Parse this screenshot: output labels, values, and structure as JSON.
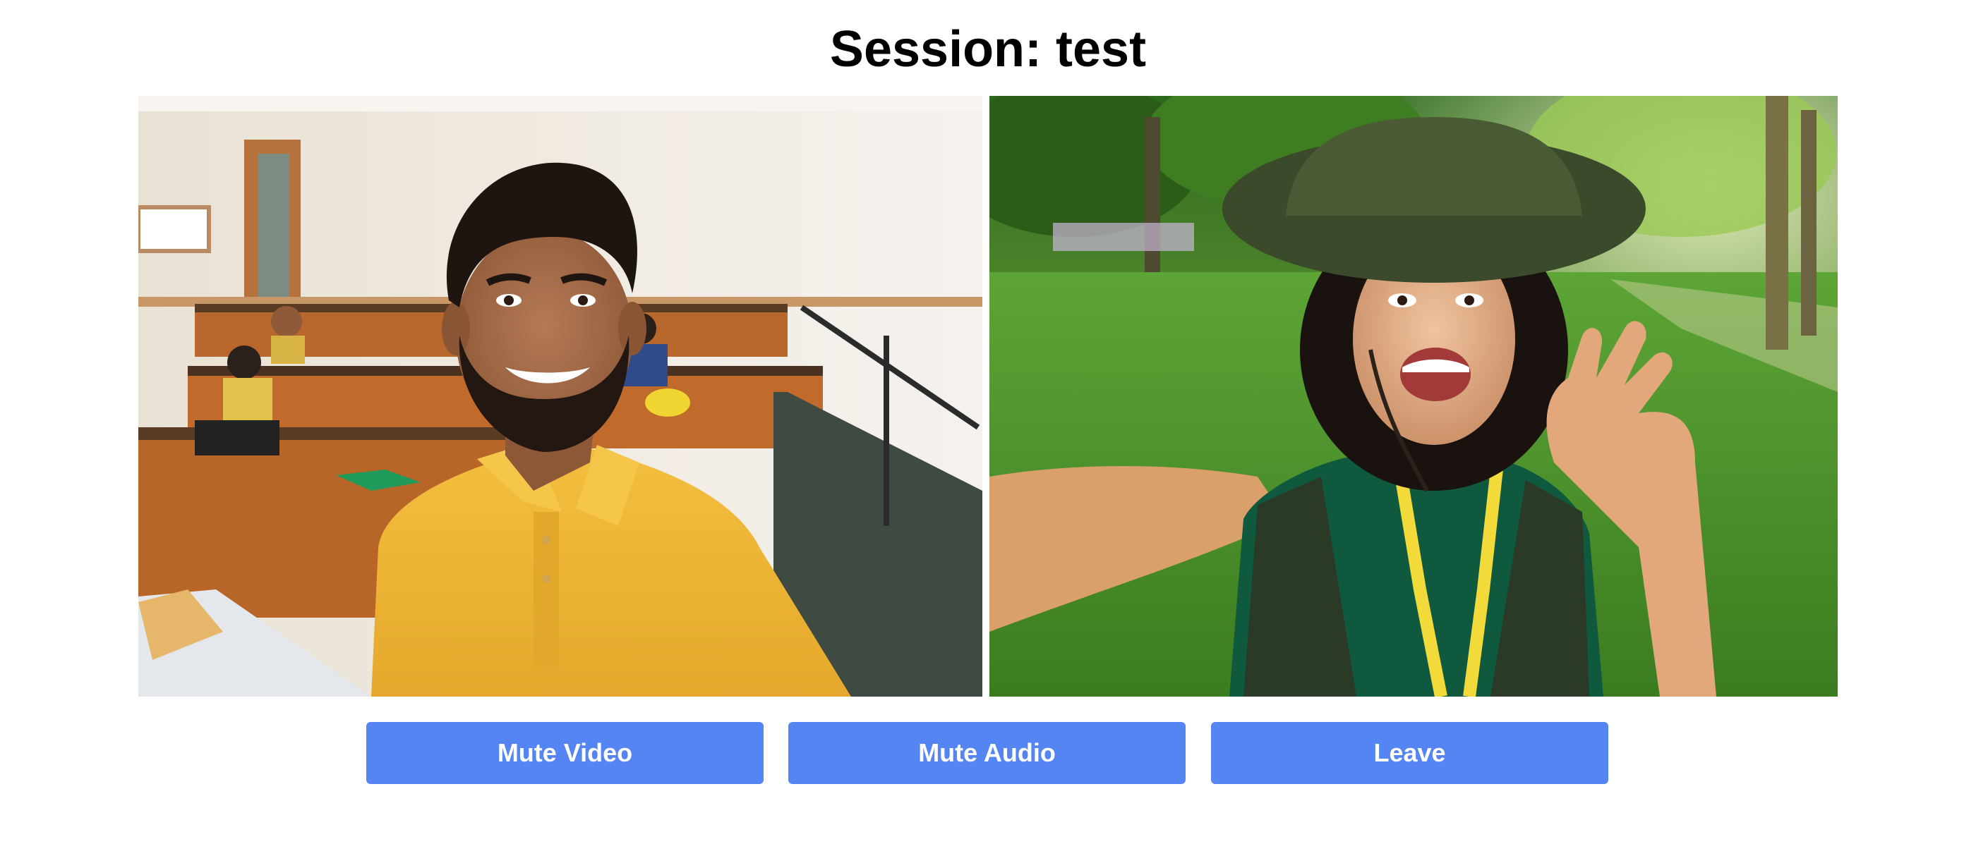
{
  "session": {
    "title": "Session: test"
  },
  "videos": [
    {
      "name": "remote-video-participant-1"
    },
    {
      "name": "remote-video-participant-2"
    }
  ],
  "controls": {
    "mute_video_label": "Mute Video",
    "mute_audio_label": "Mute Audio",
    "leave_label": "Leave"
  },
  "colors": {
    "button_background": "#5585f3",
    "button_text": "#ffffff",
    "background": "#ffffff",
    "title_text": "#000000"
  }
}
